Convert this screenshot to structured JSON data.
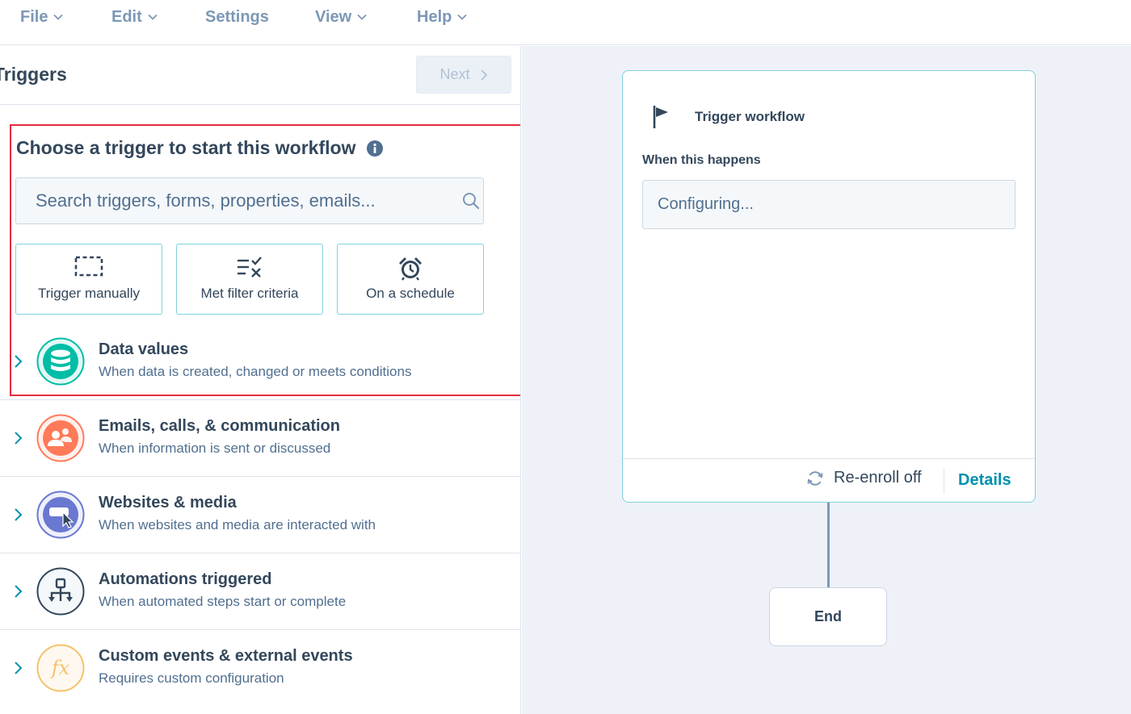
{
  "menu": {
    "file": "File",
    "edit": "Edit",
    "settings": "Settings",
    "view": "View",
    "help": "Help"
  },
  "panel": {
    "title": "Triggers",
    "next_label": "Next"
  },
  "chooser": {
    "title": "Choose a trigger to start this workflow",
    "search_placeholder": "Search triggers, forms, properties, emails..."
  },
  "quick_options": [
    {
      "label": "Trigger manually",
      "icon": "dashed-square-icon"
    },
    {
      "label": "Met filter criteria",
      "icon": "filter-check-icon"
    },
    {
      "label": "On a schedule",
      "icon": "alarm-clock-icon"
    }
  ],
  "categories": [
    {
      "title": "Data values",
      "description": "When data is created, changed or meets conditions",
      "icon": "database-icon",
      "color": "#00bda5"
    },
    {
      "title": "Emails, calls, & communication",
      "description": "When information is sent or discussed",
      "icon": "people-chat-icon",
      "color": "#ff7a59"
    },
    {
      "title": "Websites & media",
      "description": "When websites and media are interacted with",
      "icon": "cursor-click-icon",
      "color": "#6a78d1"
    },
    {
      "title": "Automations triggered",
      "description": "When automated steps start or complete",
      "icon": "workflow-icon",
      "color": "#33475b"
    },
    {
      "title": "Custom events & external events",
      "description": "Requires custom configuration",
      "icon": "function-icon",
      "color": "#f5c26b"
    }
  ],
  "trigger_card": {
    "title": "Trigger workflow",
    "when_label": "When this happens",
    "config_value": "Configuring...",
    "reenroll_label": "Re-enroll off",
    "details_label": "Details"
  },
  "end_node": {
    "label": "End"
  },
  "colors": {
    "accent": "#0091ae",
    "card_border": "#7fd1de",
    "highlight": "#e22d3c",
    "text": "#33475b",
    "canvas_bg": "#eef2f8"
  }
}
